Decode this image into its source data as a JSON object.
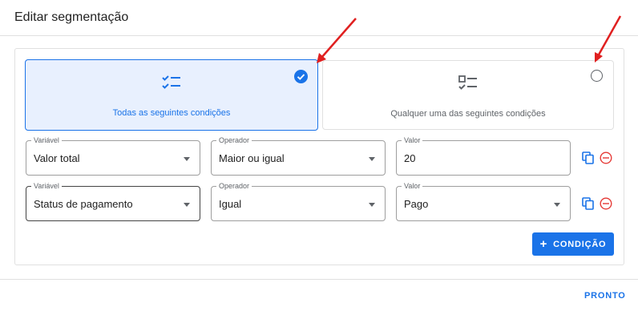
{
  "dialog": {
    "title": "Editar segmentação",
    "done_label": "PRONTO"
  },
  "match_mode": {
    "options": [
      {
        "label": "Todas as seguintes condições",
        "icon": "checklist-icon",
        "selected": true
      },
      {
        "label": "Qualquer uma das seguintes condições",
        "icon": "checklist-partial-icon",
        "selected": false
      }
    ]
  },
  "conditions": [
    {
      "variable": {
        "label": "Variável",
        "value": "Valor total"
      },
      "operator": {
        "label": "Operador",
        "value": "Maior ou igual"
      },
      "value": {
        "label": "Valor",
        "value": "20"
      }
    },
    {
      "variable": {
        "label": "Variável",
        "value": "Status de pagamento"
      },
      "operator": {
        "label": "Operador",
        "value": "Igual"
      },
      "value": {
        "label": "Valor",
        "value": "Pago"
      }
    }
  ],
  "add_condition": {
    "label": "CONDIÇÃO",
    "icon": "plus-icon"
  },
  "colors": {
    "accent": "#1a73e8",
    "selected_bg": "#e8f0fe",
    "remove": "#e53935",
    "annotation_arrow": "#e02020"
  },
  "annotations": {
    "arrows": 2
  }
}
